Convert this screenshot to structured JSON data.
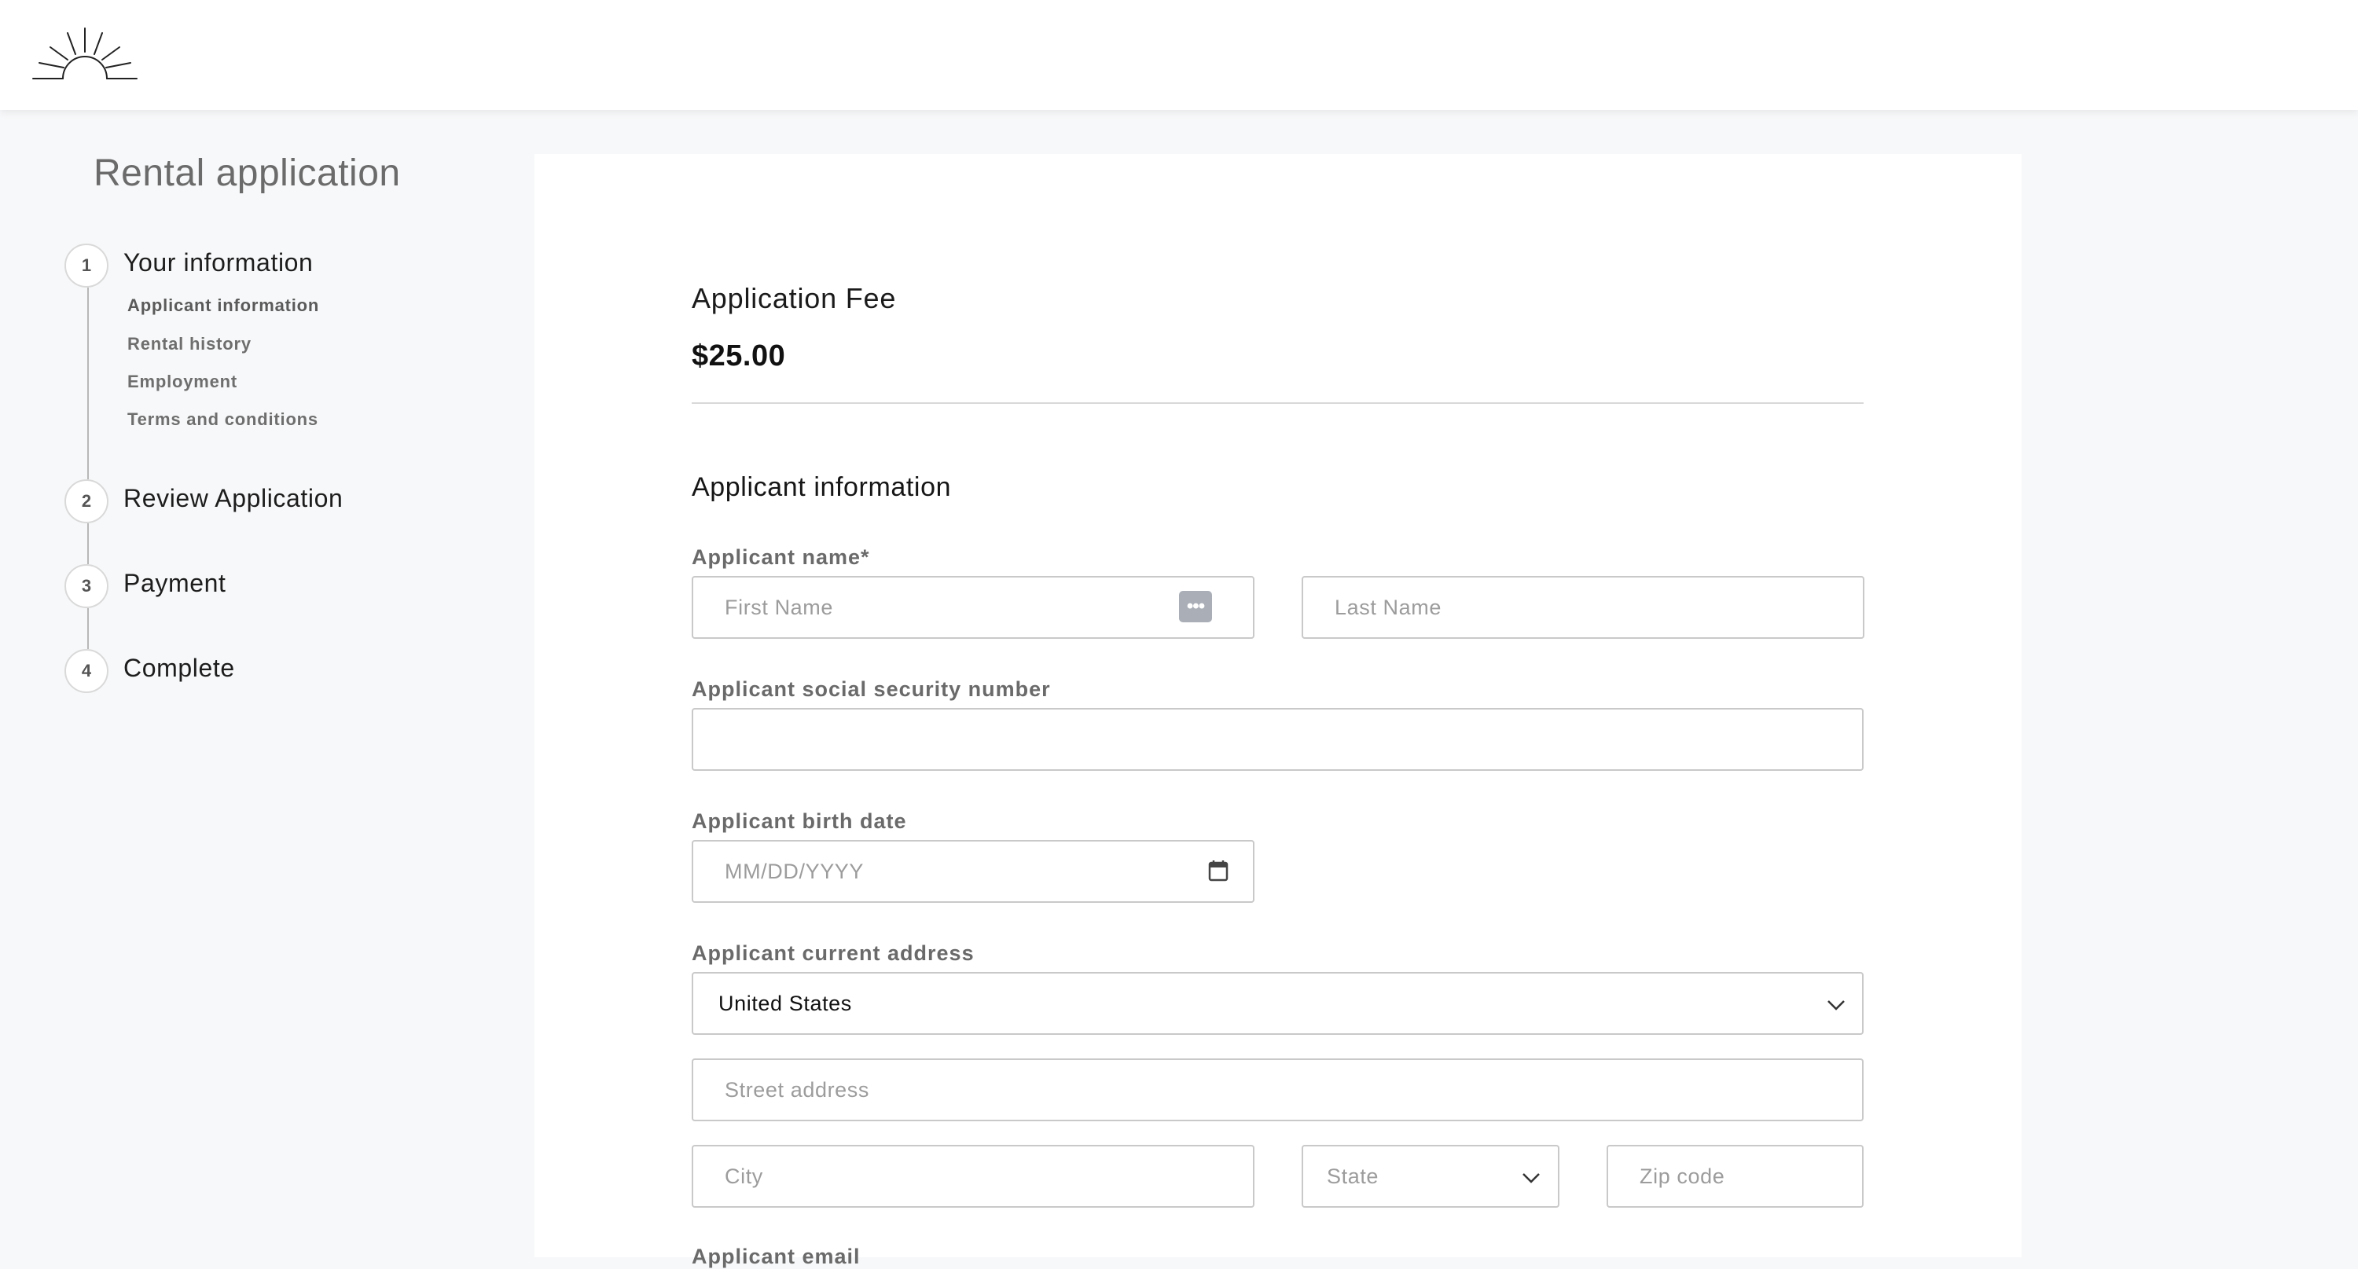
{
  "app": {
    "title": "Rental application"
  },
  "stepper": {
    "steps": [
      {
        "number": "1",
        "label": "Your information",
        "substeps": [
          "Applicant information",
          "Rental history",
          "Employment",
          "Terms and conditions"
        ]
      },
      {
        "number": "2",
        "label": "Review Application"
      },
      {
        "number": "3",
        "label": "Payment"
      },
      {
        "number": "4",
        "label": "Complete"
      }
    ]
  },
  "fee": {
    "title": "Application Fee",
    "amount": "$25.00"
  },
  "form": {
    "section_title": "Applicant information",
    "name_label": "Applicant name*",
    "first_name_placeholder": "First Name",
    "last_name_placeholder": "Last Name",
    "ssn_label": "Applicant social security number",
    "ssn_value": "",
    "birth_label": "Applicant birth date",
    "birth_placeholder": "MM/DD/YYYY",
    "address_label": "Applicant current address",
    "country_value": "United States",
    "street_placeholder": "Street address",
    "city_placeholder": "City",
    "state_placeholder": "State",
    "zip_placeholder": "Zip code",
    "email_label": "Applicant email"
  },
  "icons": {
    "logo": "sunrise-logo",
    "password_manager": "password-manager-icon",
    "calendar": "calendar-icon",
    "dropdown": "chevron-down-icon"
  },
  "colors": {
    "background": "#f7f8f9",
    "card": "#ffffff",
    "border": "#c9c9c9",
    "text_muted": "#6a6a6a"
  }
}
